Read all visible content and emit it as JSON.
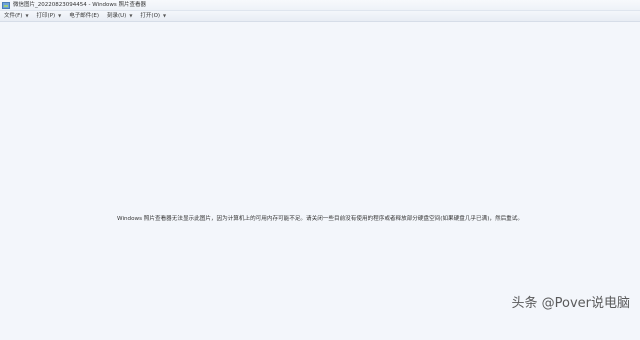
{
  "window": {
    "title": "微信图片_20220823094454 - Windows 照片查看器",
    "icon": "photo-viewer-icon"
  },
  "menubar": {
    "items": [
      {
        "label": "文件(F)",
        "icon": "chevron-down-icon"
      },
      {
        "label": "打印(P)",
        "icon": "chevron-down-icon"
      },
      {
        "label": "电子邮件(E)",
        "icon": null
      },
      {
        "label": "刻录(U)",
        "icon": "chevron-down-icon"
      },
      {
        "label": "打开(O)",
        "icon": "chevron-down-icon"
      }
    ]
  },
  "main": {
    "error_message": "Windows 照片查看器无法显示此图片，因为计算机上的可用内存可能不足。请关闭一些目前没有使用的程序或者释放部分硬盘空间(如果硬盘几乎已满)，然后重试。"
  },
  "watermark": {
    "text": "头条 @Pover说电脑"
  }
}
